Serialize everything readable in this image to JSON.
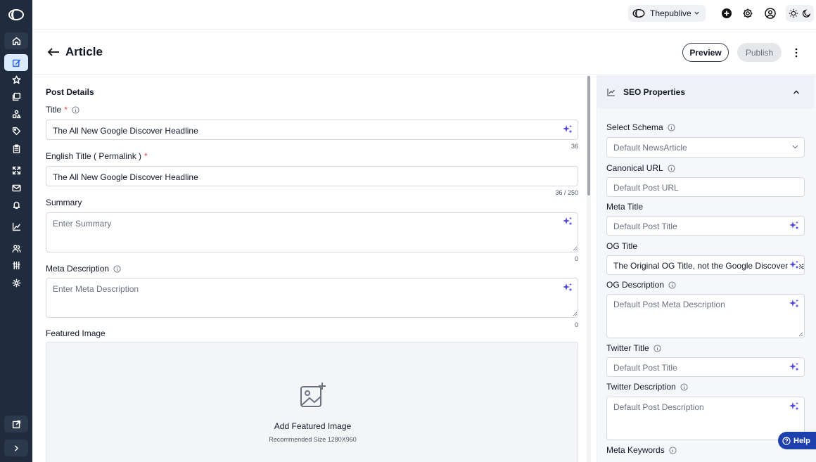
{
  "topbar": {
    "workspace": "Thepublive"
  },
  "header": {
    "title": "Article",
    "preview_label": "Preview",
    "publish_label": "Publish"
  },
  "post_details": {
    "section_title": "Post Details",
    "title_label": "Title",
    "title_value": "The All New Google Discover Headline",
    "title_count": "36",
    "english_title_label": "English Title ( Permalink )",
    "english_title_value": "The All New Google Discover Headline",
    "english_title_count": "36 / 250",
    "summary_label": "Summary",
    "summary_placeholder": "Enter Summary",
    "summary_count": "0",
    "meta_description_label": "Meta Description",
    "meta_description_placeholder": "Enter Meta Description",
    "meta_description_count": "0",
    "featured_image_label": "Featured Image",
    "featured_image_title": "Add Featured Image",
    "featured_image_hint": "Recommended Size 1280X960"
  },
  "seo": {
    "section_title": "SEO Properties",
    "select_schema_label": "Select Schema",
    "select_schema_value": "Default NewsArticle",
    "canonical_url_label": "Canonical URL",
    "canonical_url_placeholder": "Default Post URL",
    "meta_title_label": "Meta Title",
    "meta_title_placeholder": "Default Post Title",
    "og_title_label": "OG Title",
    "og_title_value": "The Original OG Title, not the Google Discover Headline",
    "og_description_label": "OG Description",
    "og_description_placeholder": "Default Post Meta Description",
    "twitter_title_label": "Twitter Title",
    "twitter_title_placeholder": "Default Post Title",
    "twitter_description_label": "Twitter Description",
    "twitter_description_placeholder": "Default Post Description",
    "meta_keywords_label": "Meta Keywords"
  },
  "help_label": "Help",
  "sidebar": {
    "items": [
      "home-icon",
      "edit-icon",
      "star-icon",
      "gallery-icon",
      "shapes-icon",
      "tag-icon",
      "clipboard-icon",
      "expand-icon",
      "mail-icon",
      "bell-icon",
      "analytics-icon",
      "users-icon",
      "sliders-icon",
      "gear-icon",
      "external-link-icon",
      "chevron-right-icon"
    ]
  },
  "colors": {
    "sidebar_bg": "#202b3d",
    "active_item_bg": "#dbeafe",
    "accent": "#2563eb",
    "sparkle": "#4f46e5",
    "help_bg": "#1e40af",
    "required": "#ef4444"
  }
}
